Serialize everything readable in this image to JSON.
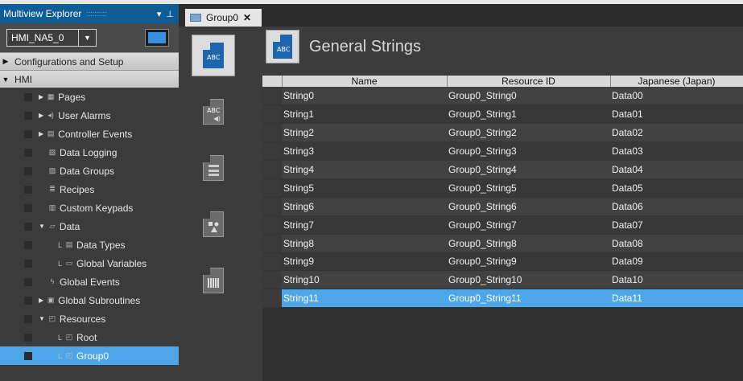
{
  "explorer": {
    "title": "Multiview Explorer",
    "device": "HMI_NA5_0",
    "sections": {
      "config": "Configurations and Setup",
      "hmi": "HMI"
    },
    "items": [
      {
        "label": "Pages",
        "icon": "pages-icon",
        "indent": 1,
        "expander": true
      },
      {
        "label": "User Alarms",
        "icon": "speaker-icon",
        "indent": 1,
        "expander": true
      },
      {
        "label": "Controller Events",
        "icon": "controller-events-icon",
        "indent": 1,
        "expander": true
      },
      {
        "label": "Data Logging",
        "icon": "data-logging-icon",
        "indent": 1,
        "expander": false
      },
      {
        "label": "Data Groups",
        "icon": "data-groups-icon",
        "indent": 1,
        "expander": false
      },
      {
        "label": "Recipes",
        "icon": "recipes-icon",
        "indent": 1,
        "expander": false
      },
      {
        "label": "Custom Keypads",
        "icon": "keypad-icon",
        "indent": 1,
        "expander": false
      },
      {
        "label": "Data",
        "icon": "data-icon",
        "indent": 1,
        "expander": true,
        "expanded": true
      },
      {
        "label": "Data Types",
        "icon": "data-types-icon",
        "indent": 2,
        "expander": false
      },
      {
        "label": "Global Variables",
        "icon": "global-variables-icon",
        "indent": 2,
        "expander": false
      },
      {
        "label": "Global Events",
        "icon": "lightning-icon",
        "indent": 1,
        "expander": false
      },
      {
        "label": "Global Subroutines",
        "icon": "subroutines-icon",
        "indent": 1,
        "expander": true
      },
      {
        "label": "Resources",
        "icon": "resources-icon",
        "indent": 1,
        "expander": true,
        "expanded": true
      },
      {
        "label": "Root",
        "icon": "folder-icon",
        "indent": 2,
        "expander": false
      },
      {
        "label": "Group0",
        "icon": "folder-icon",
        "indent": 2,
        "expander": false,
        "selected": true
      }
    ]
  },
  "tab": {
    "label": "Group0"
  },
  "header": {
    "title": "General Strings"
  },
  "table": {
    "columns": [
      "Name",
      "Resource ID",
      "Japanese (Japan)"
    ],
    "rows": [
      [
        "String0",
        "Group0_String0",
        "Data00"
      ],
      [
        "String1",
        "Group0_String1",
        "Data01"
      ],
      [
        "String2",
        "Group0_String2",
        "Data02"
      ],
      [
        "String3",
        "Group0_String3",
        "Data03"
      ],
      [
        "String4",
        "Group0_String4",
        "Data04"
      ],
      [
        "String5",
        "Group0_String5",
        "Data05"
      ],
      [
        "String6",
        "Group0_String6",
        "Data06"
      ],
      [
        "String7",
        "Group0_String7",
        "Data07"
      ],
      [
        "String8",
        "Group0_String8",
        "Data08"
      ],
      [
        "String9",
        "Group0_String9",
        "Data09"
      ],
      [
        "String10",
        "Group0_String10",
        "Data10"
      ],
      [
        "String11",
        "Group0_String11",
        "Data11"
      ]
    ],
    "selected_row": 11
  },
  "colors": {
    "accent": "#4ea5e8",
    "title_bar": "#0e5d96",
    "panel": "#3b3b3b"
  }
}
